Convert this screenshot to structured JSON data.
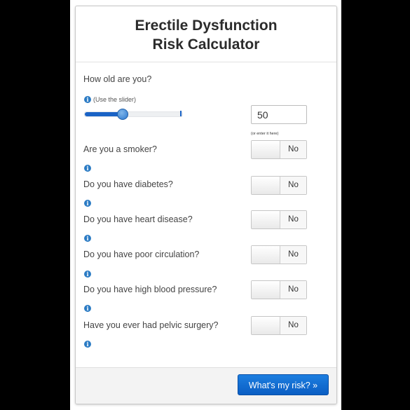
{
  "calculator": {
    "title_line1": "Erectile Dysfunction",
    "title_line2": "Risk Calculator",
    "age_question": "How old are you?",
    "age_hint": "(Use the slider)",
    "age_value": "50",
    "age_slider_fraction": 0.38,
    "age_input_hint": "(or enter it here)",
    "info_icon_glyph": "i",
    "questions": [
      {
        "label": "Are you a smoker?",
        "value": "No"
      },
      {
        "label": "Do you have diabetes?",
        "value": "No"
      },
      {
        "label": "Do you have heart disease?",
        "value": "No"
      },
      {
        "label": "Do you have poor circulation?",
        "value": "No"
      },
      {
        "label": "Do you have high blood pressure?",
        "value": "No"
      },
      {
        "label": "Have you ever had pelvic surgery?",
        "value": "No"
      }
    ],
    "submit_label": "What's my risk? »"
  },
  "colors": {
    "accent": "#1a63c6",
    "button": "#0b5ec4",
    "info_icon": "#2b7bc4"
  }
}
